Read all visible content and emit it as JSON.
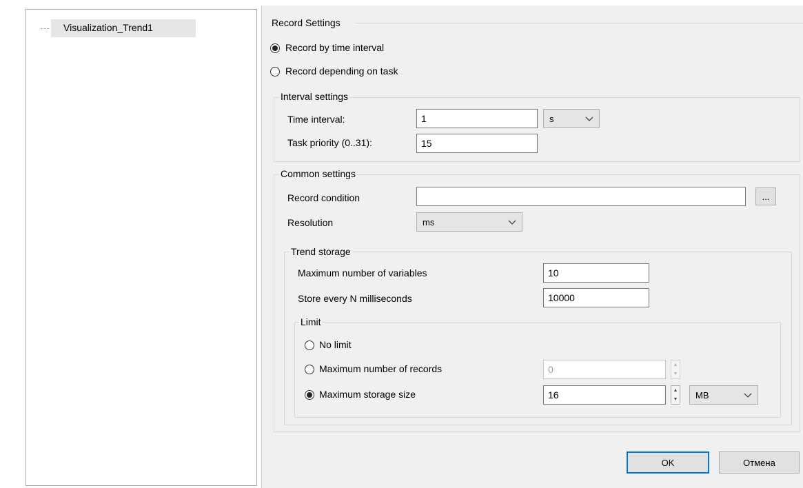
{
  "tree": {
    "item": "Visualization_Trend1"
  },
  "record_settings": {
    "title": "Record Settings",
    "radio_time": "Record by time interval",
    "radio_task": "Record depending on task",
    "selected": "time"
  },
  "interval": {
    "title": "Interval settings",
    "time_label": "Time interval:",
    "time_value": "1",
    "time_unit": "s",
    "priority_label": "Task priority (0..31):",
    "priority_value": "15"
  },
  "common": {
    "title": "Common settings",
    "condition_label": "Record condition",
    "condition_value": "",
    "ellipsis": "...",
    "resolution_label": "Resolution",
    "resolution_value": "ms"
  },
  "storage": {
    "title": "Trend storage",
    "max_vars_label": "Maximum number of variables",
    "max_vars_value": "10",
    "store_every_label": "Store every N milliseconds",
    "store_every_value": "10000"
  },
  "limit": {
    "title": "Limit",
    "no_limit": "No limit",
    "max_records": "Maximum number of records",
    "max_records_value": "0",
    "max_size": "Maximum storage size",
    "max_size_value": "16",
    "size_unit": "MB",
    "selected": "max_size"
  },
  "buttons": {
    "ok": "OK",
    "cancel": "Отмена"
  },
  "colors": {
    "focus_border": "#0078d7",
    "panel_bg": "#f0f0f0"
  }
}
